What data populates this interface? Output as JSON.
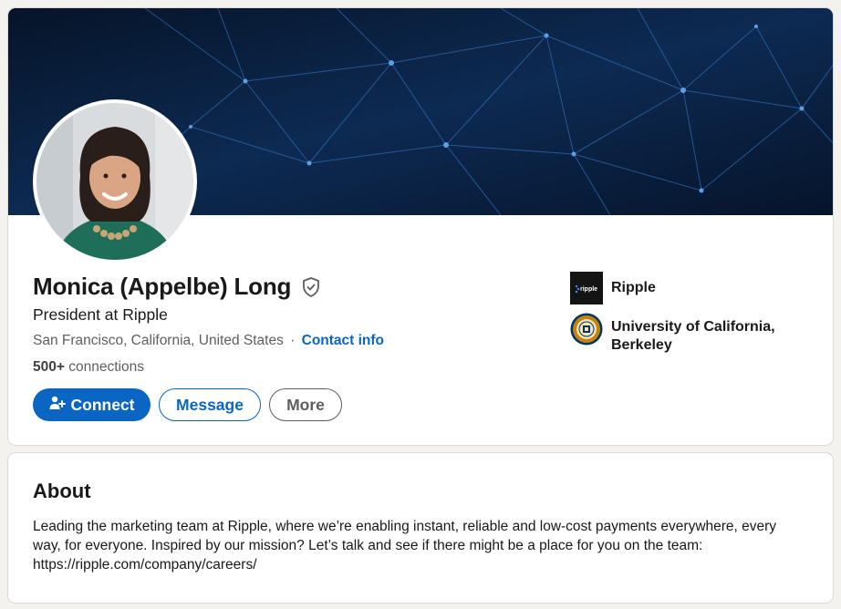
{
  "profile": {
    "name": "Monica (Appelbe) Long",
    "headline": "President at Ripple",
    "location": "San Francisco, California, United States",
    "separator": "·",
    "contact_info_label": "Contact info",
    "connections_count": "500+",
    "connections_label": "connections",
    "verified_icon": "shield-check-icon"
  },
  "actions": {
    "connect_label": "Connect",
    "connect_icon": "add-person-icon",
    "message_label": "Message",
    "more_label": "More"
  },
  "sidebar": {
    "company": {
      "name": "Ripple",
      "logo_text": "ripple"
    },
    "education": {
      "name": "University of California, Berkeley"
    }
  },
  "about": {
    "title": "About",
    "text": "Leading the marketing team at Ripple, where we’re enabling instant, reliable and low-cost payments everywhere, every way, for everyone. Inspired by our mission? Let’s talk and see if there might be a place for you on the team: https://ripple.com/company/careers/"
  },
  "colors": {
    "accent": "#0a66c2",
    "banner_bg": "#0a1a33",
    "page_bg": "#f4f2ee"
  }
}
